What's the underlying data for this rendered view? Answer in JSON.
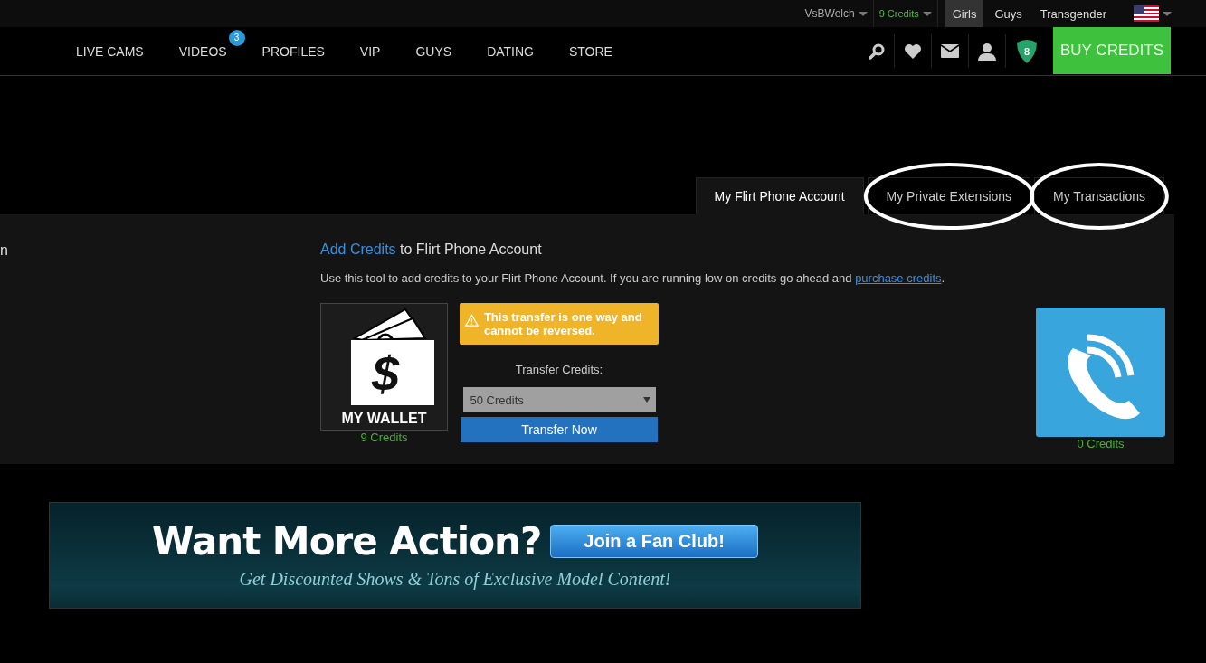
{
  "top_bar": {
    "username": "VsBWelch",
    "credits": "9 Credits",
    "categories": [
      {
        "label": "Girls",
        "selected": true
      },
      {
        "label": "Guys",
        "selected": false
      },
      {
        "label": "Transgender",
        "selected": false
      }
    ]
  },
  "nav": {
    "items": [
      {
        "label": "LIVE CAMS"
      },
      {
        "label": "VIDEOS",
        "badge": "3"
      },
      {
        "label": "PROFILES"
      },
      {
        "label": "VIP"
      },
      {
        "label": "GUYS"
      },
      {
        "label": "DATING"
      },
      {
        "label": "STORE"
      }
    ],
    "shield_badge": "8",
    "buy_button": "BUY CREDITS"
  },
  "tabs": [
    {
      "label": "My Flirt Phone Account",
      "selected": true,
      "circled": false
    },
    {
      "label": "My Private Extensions",
      "selected": false,
      "circled": true
    },
    {
      "label": "My Transactions",
      "selected": false,
      "circled": true
    }
  ],
  "panel": {
    "side_text": "n",
    "heading": {
      "link": "Add Credits",
      "rest": " to Flirt Phone Account"
    },
    "description": {
      "before": "Use this tool to add credits to your Flirt Phone Account. If you are running low on credits go ahead and ",
      "link": "purchase credits",
      "after": "."
    },
    "wallet": {
      "symbol": "$",
      "label": "MY WALLET",
      "credits": "9 Credits"
    },
    "warning": "This transfer is one way and cannot be reversed.",
    "transfer_label": "Transfer Credits:",
    "amount_select": "50 Credits",
    "transfer_button": "Transfer Now",
    "phone": {
      "credits": "0 Credits"
    }
  },
  "banner": {
    "headline": "Want More Action?",
    "button": "Join a Fan Club!",
    "tagline": "Get Discounted Shows & Tons of Exclusive Model Content!"
  }
}
